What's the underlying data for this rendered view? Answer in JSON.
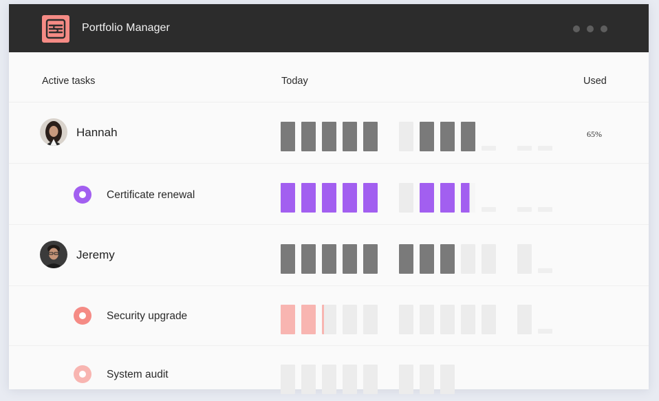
{
  "app": {
    "title": "Portfolio Manager"
  },
  "colors": {
    "titlebar": "#2c2c2c",
    "logo": "#f58b85",
    "gray_bar": "#7a7a7a",
    "faint_bar": "#ececec",
    "purple": "#a25ff0",
    "coral": "#f58b85",
    "pink": "#f8b5b1"
  },
  "header": {
    "col_tasks": "Active tasks",
    "col_today": "Today",
    "col_used": "Used"
  },
  "rows": [
    {
      "type": "person",
      "name": "Hannah",
      "avatar": "avatar-hannah",
      "used": "65%",
      "bars": [
        "gray",
        "gray",
        "gray",
        "gray",
        "gray",
        "gap",
        "faint",
        "gray",
        "gray",
        "gray",
        "dash",
        "gap",
        "dash",
        "dash"
      ]
    },
    {
      "type": "task",
      "name": "Certificate renewal",
      "ring": "purple",
      "used": "",
      "bars": [
        "purple",
        "purple",
        "purple",
        "purple",
        "purple",
        "gap",
        "faint",
        "purple",
        "purple",
        "purple-half",
        "dash",
        "gap",
        "dash",
        "dash"
      ]
    },
    {
      "type": "person",
      "name": "Jeremy",
      "avatar": "avatar-jeremy",
      "used": "",
      "bars": [
        "gray",
        "gray",
        "gray",
        "gray",
        "gray",
        "gap",
        "gray",
        "gray",
        "gray",
        "faint",
        "faint",
        "gap",
        "faint",
        "dash"
      ]
    },
    {
      "type": "task",
      "name": "Security upgrade",
      "ring": "coral",
      "used": "",
      "bars": [
        "pink",
        "pink",
        "faint-half",
        "faint",
        "faint",
        "gap",
        "faint",
        "faint",
        "faint",
        "faint",
        "faint",
        "gap",
        "faint",
        "dash"
      ]
    },
    {
      "type": "task",
      "name": "System audit",
      "ring": "pink",
      "used": "",
      "bars": [
        "faint",
        "faint",
        "faint",
        "faint",
        "faint",
        "gap",
        "faint",
        "faint",
        "faint",
        "none",
        "none",
        "gap",
        "none",
        "none"
      ]
    }
  ]
}
